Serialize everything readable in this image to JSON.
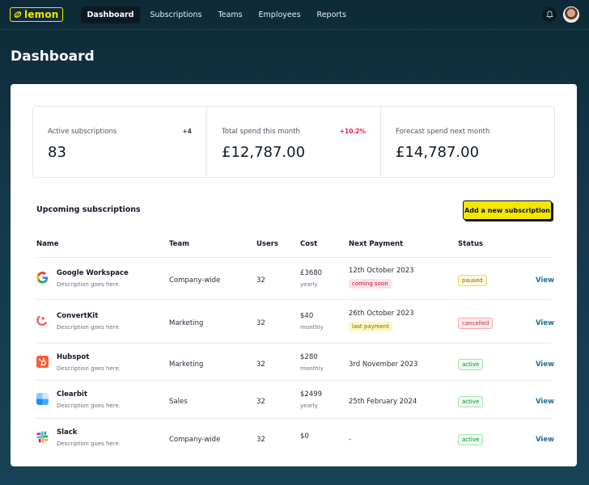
{
  "app": {
    "logo": "lemon"
  },
  "nav": {
    "items": [
      {
        "label": "Dashboard",
        "active": true
      },
      {
        "label": "Subscriptions"
      },
      {
        "label": "Teams"
      },
      {
        "label": "Employees"
      },
      {
        "label": "Reports"
      }
    ]
  },
  "page": {
    "title": "Dashboard"
  },
  "stats": [
    {
      "label": "Active subscriptions",
      "value": "83",
      "delta": "+4"
    },
    {
      "label": "Total spend this month",
      "value": "£12,787.00",
      "delta": "+10.2%"
    },
    {
      "label": "Forecast spend next month",
      "value": "£14,787.00",
      "delta": ""
    }
  ],
  "upcoming": {
    "title": "Upcoming subscriptions",
    "add_button": "Add a new subscription",
    "columns": [
      "Name",
      "Team",
      "Users",
      "Cost",
      "Next Payment",
      "Status"
    ],
    "rows": [
      {
        "name": "Google Workspace",
        "description": "Description goes here.",
        "team": "Company-wide",
        "users": "32",
        "cost": "£3680",
        "period": "yearly",
        "next_payment": "12th October 2023",
        "payment_tag": "coming soon",
        "status": "paused",
        "view": "View",
        "icon": "google-icon"
      },
      {
        "name": "ConvertKit",
        "description": "Description goes here.",
        "team": "Marketing",
        "users": "32",
        "cost": "$40",
        "period": "monthly",
        "next_payment": "26th October 2023",
        "payment_tag": "last payment",
        "status": "cancelled",
        "view": "View",
        "icon": "convertkit-icon"
      },
      {
        "name": "Hubspot",
        "description": "Description goes here.",
        "team": "Marketing",
        "users": "32",
        "cost": "$280",
        "period": "monthly",
        "next_payment": "3rd November 2023",
        "payment_tag": "",
        "status": "active",
        "view": "View",
        "icon": "hubspot-icon"
      },
      {
        "name": "Clearbit",
        "description": "Description goes here.",
        "team": "Sales",
        "users": "32",
        "cost": "$2499",
        "period": "yearly",
        "next_payment": "25th February 2024",
        "payment_tag": "",
        "status": "active",
        "view": "View",
        "icon": "clearbit-icon"
      },
      {
        "name": "Slack",
        "description": "Description goes here.",
        "team": "Company-wide",
        "users": "32",
        "cost": "$0",
        "period": "",
        "next_payment": "-",
        "payment_tag": "",
        "status": "active",
        "view": "View",
        "icon": "slack-icon"
      }
    ]
  },
  "colors": {
    "accent": "#f3e600",
    "link": "#1e6f97",
    "background": "#13384a"
  }
}
